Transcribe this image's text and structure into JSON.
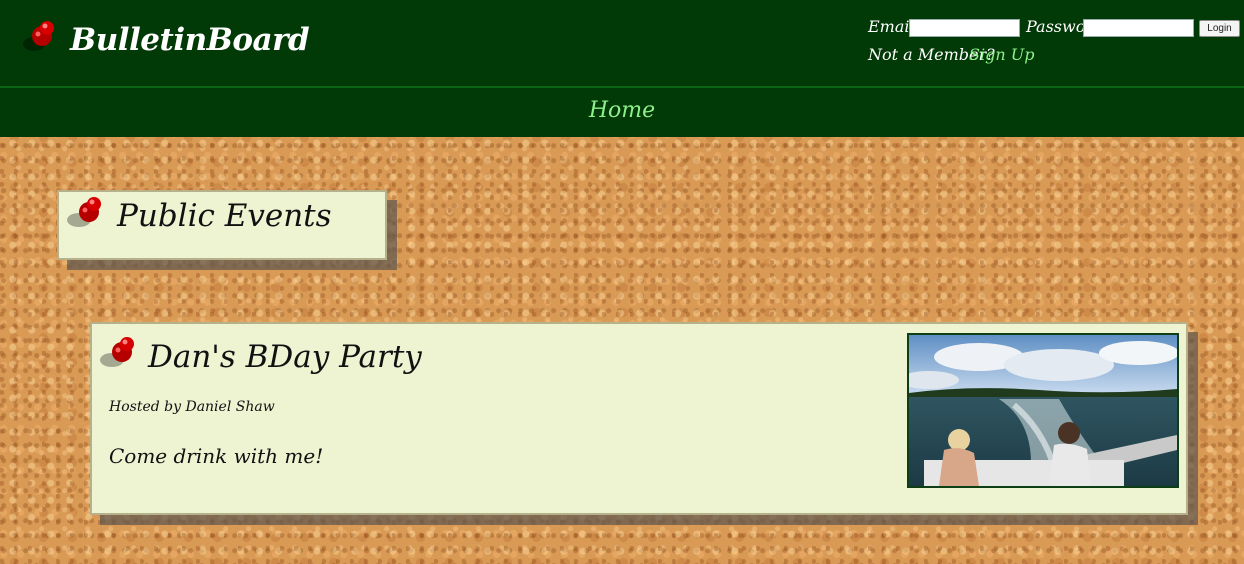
{
  "header": {
    "logo_text": "BulletinBoard",
    "logo_icon": "pushpin-icon"
  },
  "login": {
    "email_label": "Email:",
    "email_value": "",
    "password_label": "Password:",
    "password_value": "",
    "login_button": "Login",
    "not_member_text": "Not a Member?",
    "signup_link": "Sign Up"
  },
  "nav": {
    "items": [
      {
        "label": "Home"
      }
    ]
  },
  "section": {
    "title": "Public Events",
    "icon": "pushpin-icon"
  },
  "events": [
    {
      "title": "Dan's BDay Party",
      "host": "Hosted by Daniel Shaw",
      "description": "Come drink with me!",
      "image": "boat-lake-photo"
    }
  ],
  "colors": {
    "header_bg": "#013a06",
    "accent_green": "#8ef08b",
    "card_bg": "#eef3d2",
    "cork": "#d99a55",
    "pin_red": "#c40000"
  }
}
